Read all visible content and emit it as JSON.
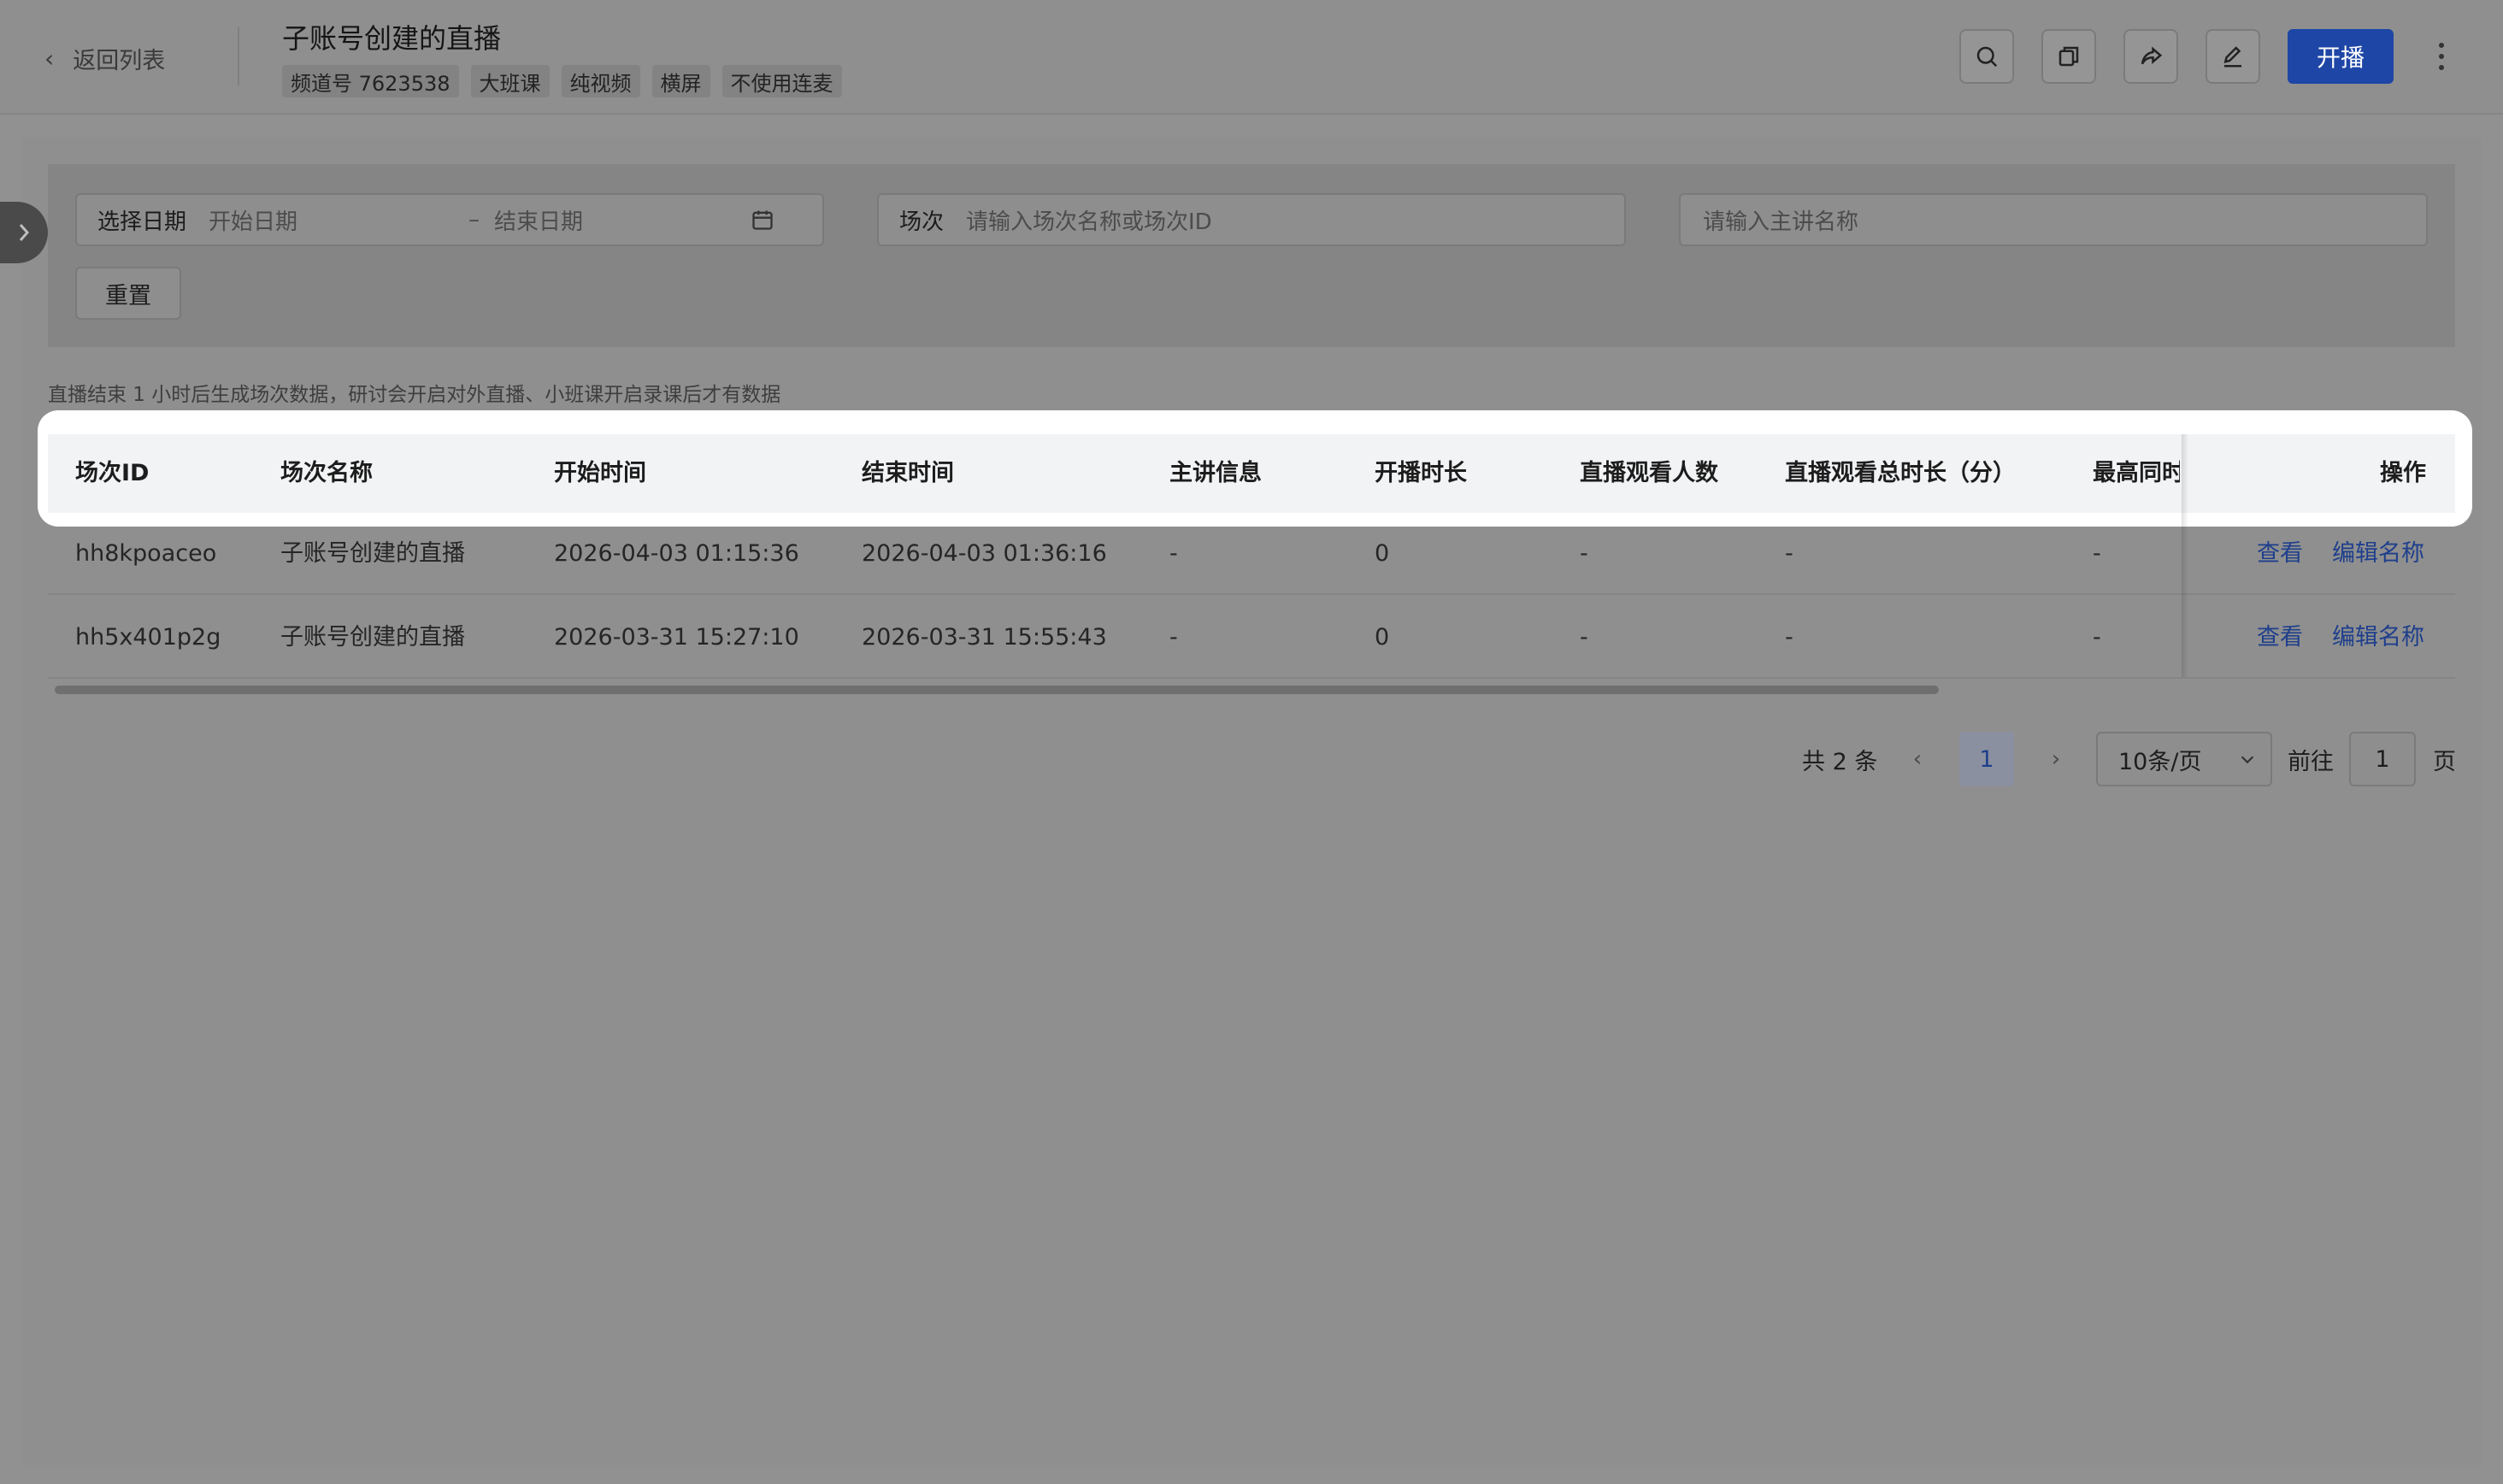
{
  "header": {
    "back_label": "返回列表",
    "title": "子账号创建的直播",
    "tags": [
      "频道号 7623538",
      "大班课",
      "纯视频",
      "横屏",
      "不使用连麦"
    ],
    "start_button": "开播",
    "tool_icons": [
      "search-icon",
      "copy-icon",
      "share-icon",
      "edit-icon"
    ]
  },
  "filters": {
    "date_label": "选择日期",
    "start_placeholder": "开始日期",
    "range_separator": "–",
    "end_placeholder": "结束日期",
    "session_label": "场次",
    "session_placeholder": "请输入场次名称或场次ID",
    "speaker_placeholder": "请输入主讲名称",
    "reset_button": "重置"
  },
  "notice": "直播结束 1 小时后生成场次数据，研讨会开启对外直播、小班课开启录课后才有数据",
  "table": {
    "columns": [
      "场次ID",
      "场次名称",
      "开始时间",
      "结束时间",
      "主讲信息",
      "开播时长",
      "直播观看人数",
      "直播观看总时长（分）",
      "最高同时",
      "操作"
    ],
    "rows": [
      {
        "id": "hh8kpoaceo",
        "name": "子账号创建的直播",
        "start": "2026-04-03 01:15:36",
        "end": "2026-04-03 01:36:16",
        "speaker": "-",
        "duration": "0",
        "viewers": "-",
        "watch_minutes": "-",
        "peak": "-",
        "view": "查看",
        "rename": "编辑名称"
      },
      {
        "id": "hh5x401p2g",
        "name": "子账号创建的直播",
        "start": "2026-03-31 15:27:10",
        "end": "2026-03-31 15:55:43",
        "speaker": "-",
        "duration": "0",
        "viewers": "-",
        "watch_minutes": "-",
        "peak": "-",
        "view": "查看",
        "rename": "编辑名称"
      }
    ]
  },
  "pagination": {
    "total": "共 2 条",
    "current_page": "1",
    "page_size": "10条/页",
    "goto_label": "前往",
    "goto_value": "1",
    "page_suffix": "页"
  },
  "colors": {
    "primary": "#1e46a6",
    "link": "#1e3f8c",
    "overlay": "#919191",
    "header_highlight": "#ffffff"
  }
}
